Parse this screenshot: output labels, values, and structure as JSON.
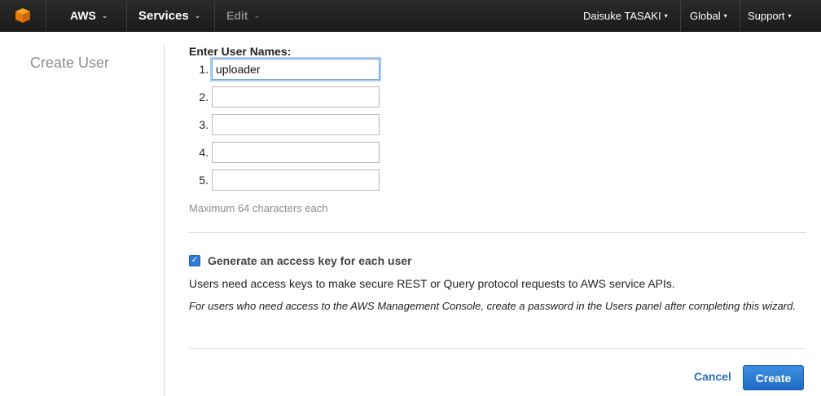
{
  "nav": {
    "aws_label": "AWS",
    "services_label": "Services",
    "edit_label": "Edit",
    "user_label": "Daisuke TASAKI",
    "region_label": "Global",
    "support_label": "Support",
    "logo_icon": "aws-cube-icon",
    "accent": "#f29100"
  },
  "sidebar": {
    "title": "Create User"
  },
  "form": {
    "section_label": "Enter User Names:",
    "rows": [
      {
        "num": "1.",
        "value": "uploader"
      },
      {
        "num": "2.",
        "value": ""
      },
      {
        "num": "3.",
        "value": ""
      },
      {
        "num": "4.",
        "value": ""
      },
      {
        "num": "5.",
        "value": ""
      }
    ],
    "hint": "Maximum 64 characters each",
    "checkbox_label": "Generate an access key for each user",
    "checkbox_checked": true,
    "description": "Users need access keys to make secure REST or Query protocol requests to AWS service APIs.",
    "note": "For users who need access to the AWS Management Console, create a password in the Users panel after completing this wizard."
  },
  "actions": {
    "cancel_label": "Cancel",
    "create_label": "Create",
    "primary_color": "#2a6ebb"
  }
}
